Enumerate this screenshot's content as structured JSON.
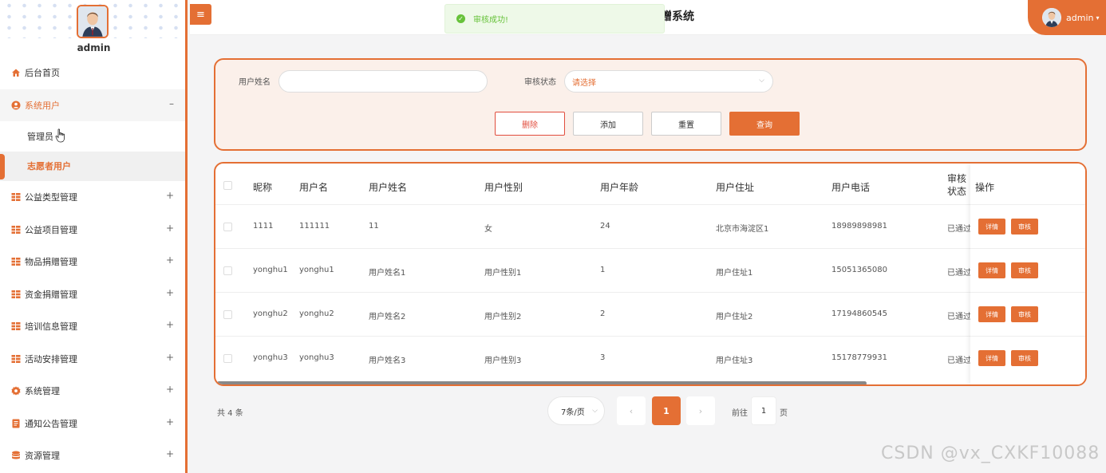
{
  "sidebar": {
    "admin_name": "admin",
    "items": [
      {
        "label": "后台首页",
        "icon": "home-icon",
        "expand": ""
      },
      {
        "label": "系统用户",
        "icon": "user-circle-icon",
        "expand": "–"
      },
      {
        "label": "公益类型管理",
        "icon": "grid-icon",
        "expand": "+"
      },
      {
        "label": "公益项目管理",
        "icon": "grid-icon",
        "expand": "+"
      },
      {
        "label": "物品捐赠管理",
        "icon": "grid-icon",
        "expand": "+"
      },
      {
        "label": "资金捐赠管理",
        "icon": "grid-icon",
        "expand": "+"
      },
      {
        "label": "培训信息管理",
        "icon": "grid-icon",
        "expand": "+"
      },
      {
        "label": "活动安排管理",
        "icon": "grid-icon",
        "expand": "+"
      },
      {
        "label": "系统管理",
        "icon": "gear-icon",
        "expand": "+"
      },
      {
        "label": "通知公告管理",
        "icon": "document-icon",
        "expand": "+"
      },
      {
        "label": "资源管理",
        "icon": "database-icon",
        "expand": "+"
      }
    ],
    "sub_items": [
      {
        "label": "管理员"
      },
      {
        "label": "志愿者用户"
      }
    ]
  },
  "topbar": {
    "hamburger_glyph": "≡",
    "title": "赠系统",
    "toast": "审核成功!",
    "user_label": "admin"
  },
  "search": {
    "name_label": "用户姓名",
    "name_value": "",
    "status_label": "审核状态",
    "status_placeholder": "请选择",
    "btn_delete": "删除",
    "btn_add": "添加",
    "btn_reset": "重置",
    "btn_query": "查询"
  },
  "table": {
    "headers": {
      "nickname": "昵称",
      "username": "用户名",
      "realname": "用户姓名",
      "gender": "用户性别",
      "age": "用户年龄",
      "address": "用户住址",
      "phone": "用户电话",
      "status": "审核状态",
      "actions": "操作"
    },
    "action_detail": "详情",
    "action_review": "审核",
    "rows": [
      {
        "nickname": "1111",
        "username": "111111",
        "realname": "11",
        "gender": "女",
        "age": "24",
        "address": "北京市海淀区1",
        "phone": "18989898981",
        "status": "已通过"
      },
      {
        "nickname": "yonghu1",
        "username": "yonghu1",
        "realname": "用户姓名1",
        "gender": "用户性别1",
        "age": "1",
        "address": "用户住址1",
        "phone": "15051365080",
        "status": "已通过"
      },
      {
        "nickname": "yonghu2",
        "username": "yonghu2",
        "realname": "用户姓名2",
        "gender": "用户性别2",
        "age": "2",
        "address": "用户住址2",
        "phone": "17194860545",
        "status": "已通过"
      },
      {
        "nickname": "yonghu3",
        "username": "yonghu3",
        "realname": "用户姓名3",
        "gender": "用户性别3",
        "age": "3",
        "address": "用户住址3",
        "phone": "15178779931",
        "status": "已通过"
      }
    ]
  },
  "pagination": {
    "total": "共 4 条",
    "page_size": "7条/页",
    "prev": "‹",
    "current": "1",
    "next": "›",
    "goto_label": "前往",
    "goto_value": "1",
    "goto_suffix": "页"
  },
  "watermark": "CSDN @vx_CXKF10088",
  "colors": {
    "accent": "#e46f34",
    "danger": "#e14d3d",
    "success": "#67c23a"
  }
}
